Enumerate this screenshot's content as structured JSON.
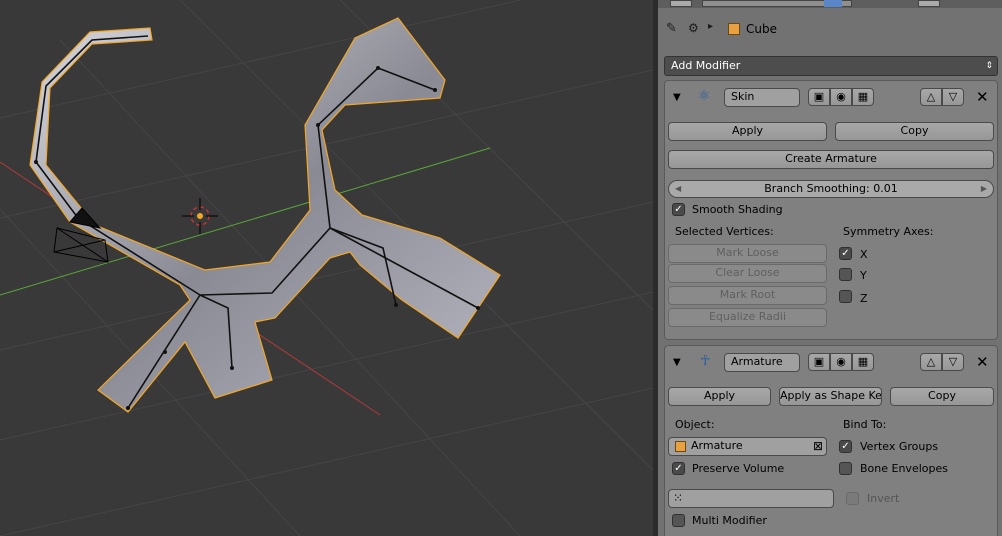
{
  "colors": {
    "viewport_bg": "#393939",
    "panel_bg": "#727272",
    "selection_outline": "#f5a623",
    "x_axis": "#b33a3a",
    "y_axis": "#5aa73a"
  },
  "header": {
    "pin_icon": "pin-icon",
    "object_icon": "cube-object-icon",
    "object_name": "Cube"
  },
  "add_modifier": {
    "label": "Add Modifier"
  },
  "skin": {
    "name": "Skin",
    "apply": "Apply",
    "copy": "Copy",
    "create_armature": "Create Armature",
    "branch_smoothing": "Branch Smoothing: 0.01",
    "smooth_shading": "Smooth Shading",
    "smooth_shading_checked": true,
    "selected_vertices": "Selected Vertices:",
    "mark_loose": "Mark Loose",
    "clear_loose": "Clear Loose",
    "mark_root": "Mark Root",
    "equalize_radii": "Equalize Radii",
    "symmetry_axes": "Symmetry Axes:",
    "axis_x": "X",
    "axis_y": "Y",
    "axis_z": "Z",
    "axis_x_checked": true,
    "axis_y_checked": false,
    "axis_z_checked": false
  },
  "armature": {
    "name": "Armature",
    "apply": "Apply",
    "apply_as_shape_key": "Apply as Shape Key",
    "copy": "Copy",
    "object_label": "Object:",
    "object_value": "Armature",
    "preserve_volume": "Preserve Volume",
    "preserve_volume_checked": true,
    "bind_to": "Bind To:",
    "vertex_groups": "Vertex Groups",
    "vertex_groups_checked": true,
    "bone_envelopes": "Bone Envelopes",
    "bone_envelopes_checked": false,
    "invert": "Invert",
    "multi_modifier": "Multi Modifier",
    "multi_modifier_checked": false
  }
}
